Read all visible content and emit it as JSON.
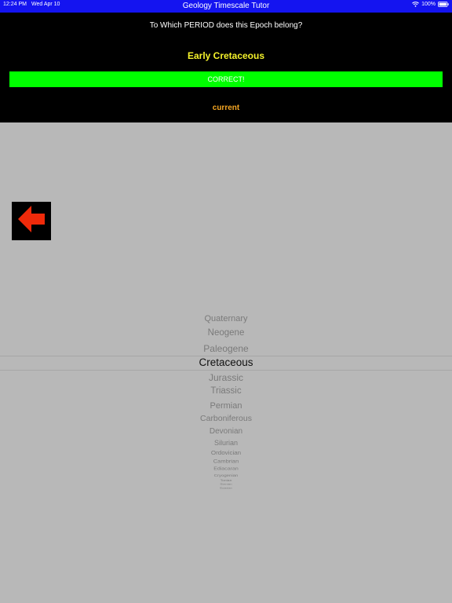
{
  "status_bar": {
    "time": "12:24 PM",
    "date": "Wed Apr 10",
    "app_title": "Geology Timescale Tutor",
    "battery_text": "100%",
    "background_color": "#1414f0"
  },
  "quiz": {
    "question": "To Which PERIOD does this Epoch belong?",
    "epoch": "Early Cretaceous",
    "result": "CORRECT!",
    "status": "current",
    "result_color": "#00ff00",
    "epoch_color": "#f5f32b",
    "status_color": "#f5a623"
  },
  "back_button": {
    "icon": "left-arrow-icon",
    "color": "#f02a0a"
  },
  "picker": {
    "selected_index": 3,
    "items": [
      "Quaternary",
      "Neogene",
      "Paleogene",
      "Cretaceous",
      "Jurassic",
      "Triassic",
      "Permian",
      "Carboniferous",
      "Devonian",
      "Silurian",
      "Ordovician",
      "Cambrian",
      "Ediacaran",
      "Cryogenian",
      "Tonian",
      "Stenian",
      "Ectasian"
    ]
  }
}
